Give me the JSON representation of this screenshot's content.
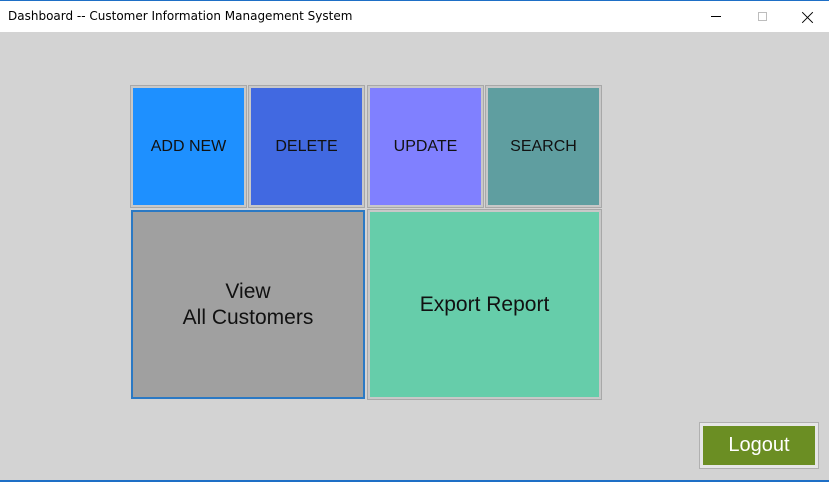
{
  "window": {
    "title": "Dashboard -- Customer Information Management System",
    "controls": {
      "minimize_icon": "minimize-icon",
      "maximize_icon": "maximize-icon",
      "close_icon": "close-icon"
    }
  },
  "tiles": {
    "add_new": {
      "label": "ADD NEW",
      "color": "#1e90ff"
    },
    "delete": {
      "label": "DELETE",
      "color": "#4169e1"
    },
    "update": {
      "label": "UPDATE",
      "color": "#8080ff"
    },
    "search": {
      "label": "SEARCH",
      "color": "#5f9ea0"
    },
    "view_all": {
      "label": "View\nAll Customers",
      "color": "#a0a0a0"
    },
    "export": {
      "label": "Export Report",
      "color": "#66cdaa"
    }
  },
  "logout": {
    "label": "Logout",
    "color": "#6b8e23"
  }
}
